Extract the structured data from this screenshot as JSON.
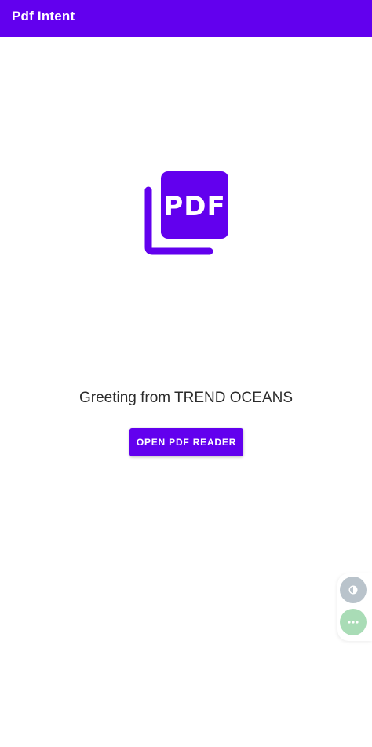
{
  "app_bar": {
    "title": "Pdf Intent",
    "background_color": "#6200EE"
  },
  "logo": {
    "icon_name": "picture-as-pdf-icon",
    "text": "PDF",
    "color": "#6200EE"
  },
  "main": {
    "greeting": "Greeting from TREND OCEANS",
    "open_button_label": "OPEN PDF READER"
  },
  "floating_controls": [
    {
      "icon_name": "contrast-icon",
      "color": "#b9c3cb"
    },
    {
      "icon_name": "more-horizontal-icon",
      "color": "#a9dcb6"
    }
  ]
}
